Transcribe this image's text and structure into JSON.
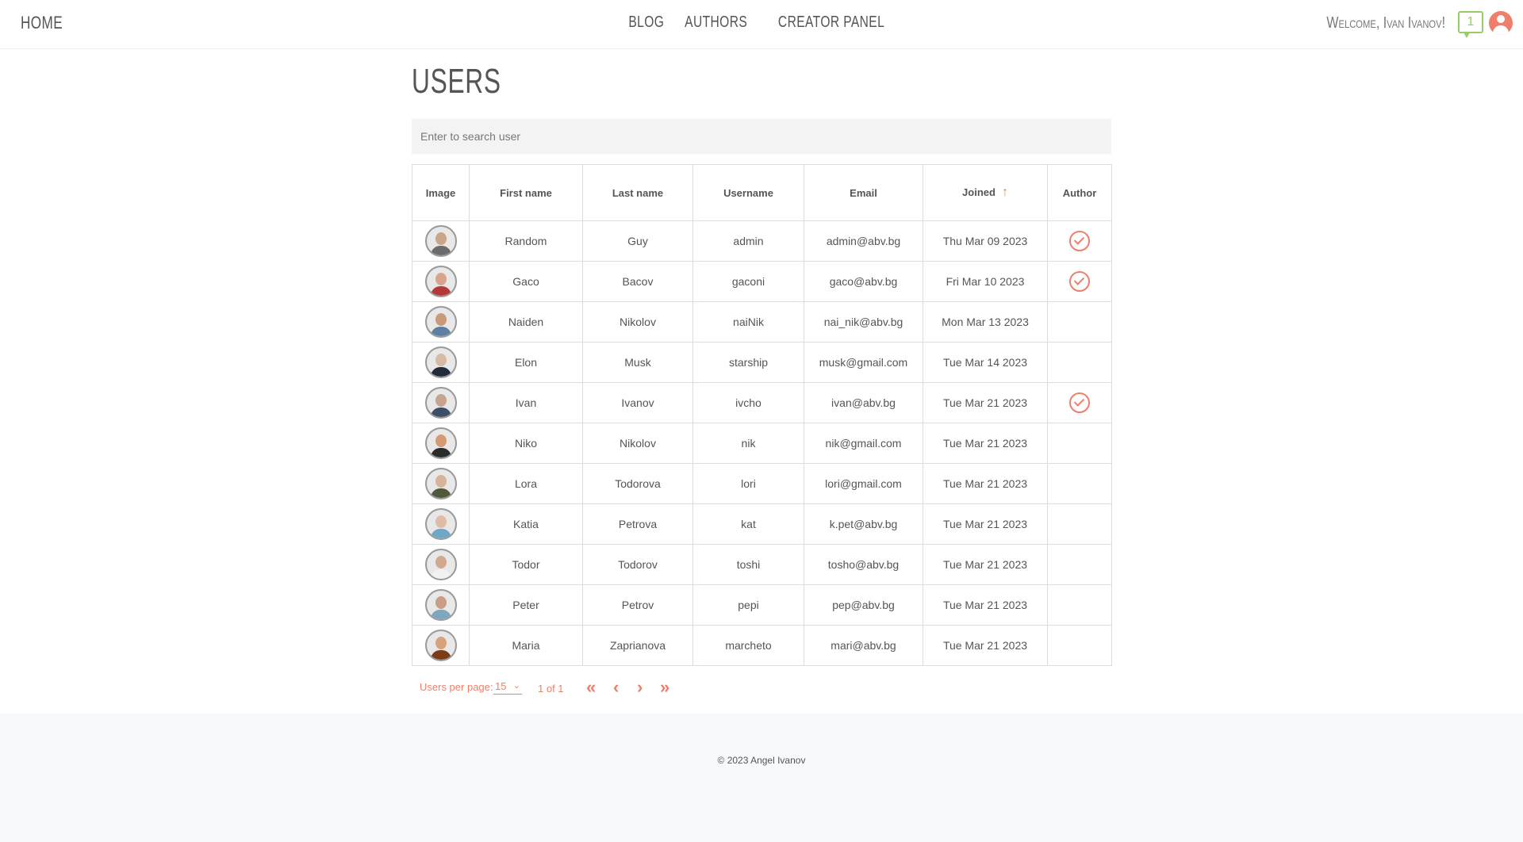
{
  "header": {
    "home": "HOME",
    "nav": [
      "BLOG",
      "AUTHORS",
      "CREATOR PANEL"
    ],
    "welcome": "Welcome, Ivan Ivanov!",
    "notification_count": "1"
  },
  "page": {
    "title": "USERS",
    "search_placeholder": "Enter to search user"
  },
  "table": {
    "columns": [
      "Image",
      "First name",
      "Last name",
      "Username",
      "Email",
      "Joined",
      "Author"
    ],
    "sort_column": "Joined",
    "sort_direction": "ascending",
    "rows": [
      {
        "first": "Random",
        "last": "Guy",
        "username": "admin",
        "email": "admin@abv.bg",
        "joined": "Thu Mar 09 2023",
        "author": true,
        "skin": "#c9a589",
        "shirt": "#6b6b6b"
      },
      {
        "first": "Gaco",
        "last": "Bacov",
        "username": "gaconi",
        "email": "gaco@abv.bg",
        "joined": "Fri Mar 10 2023",
        "author": true,
        "skin": "#d9a48c",
        "shirt": "#b43a3a"
      },
      {
        "first": "Naiden",
        "last": "Nikolov",
        "username": "naiNik",
        "email": "nai_nik@abv.bg",
        "joined": "Mon Mar 13 2023",
        "author": false,
        "skin": "#c99a7a",
        "shirt": "#5d7fa3"
      },
      {
        "first": "Elon",
        "last": "Musk",
        "username": "starship",
        "email": "musk@gmail.com",
        "joined": "Tue Mar 14 2023",
        "author": false,
        "skin": "#d8b9a4",
        "shirt": "#222b3a"
      },
      {
        "first": "Ivan",
        "last": "Ivanov",
        "username": "ivcho",
        "email": "ivan@abv.bg",
        "joined": "Tue Mar 21 2023",
        "author": true,
        "skin": "#c8a48e",
        "shirt": "#3e4e66"
      },
      {
        "first": "Niko",
        "last": "Nikolov",
        "username": "nik",
        "email": "nik@gmail.com",
        "joined": "Tue Mar 21 2023",
        "author": false,
        "skin": "#d49a74",
        "shirt": "#2b2b2b"
      },
      {
        "first": "Lora",
        "last": "Todorova",
        "username": "lori",
        "email": "lori@gmail.com",
        "joined": "Tue Mar 21 2023",
        "author": false,
        "skin": "#d7b39a",
        "shirt": "#4e5a3a"
      },
      {
        "first": "Katia",
        "last": "Petrova",
        "username": "kat",
        "email": "k.pet@abv.bg",
        "joined": "Tue Mar 21 2023",
        "author": false,
        "skin": "#e0bba5",
        "shirt": "#6fa7c7"
      },
      {
        "first": "Todor",
        "last": "Todorov",
        "username": "toshi",
        "email": "tosho@abv.bg",
        "joined": "Tue Mar 21 2023",
        "author": false,
        "skin": "#d0a88e",
        "shirt": "#f1f1f1"
      },
      {
        "first": "Peter",
        "last": "Petrov",
        "username": "pepi",
        "email": "pep@abv.bg",
        "joined": "Tue Mar 21 2023",
        "author": false,
        "skin": "#c99e84",
        "shirt": "#7fa6bf"
      },
      {
        "first": "Maria",
        "last": "Zaprianova",
        "username": "marcheto",
        "email": "mari@abv.bg",
        "joined": "Tue Mar 21 2023",
        "author": false,
        "skin": "#d8a27a",
        "shirt": "#7a3b16"
      }
    ]
  },
  "pagination": {
    "label": "Users per page:",
    "per_page": "15",
    "page_info": "1 of 1"
  },
  "footer": {
    "copyright": "© 2023 Angel Ivanov"
  },
  "colors": {
    "accent": "#ef7f6d",
    "notification": "#9acb6b",
    "text": "#555555",
    "footer_bg": "#f8f9fa"
  }
}
